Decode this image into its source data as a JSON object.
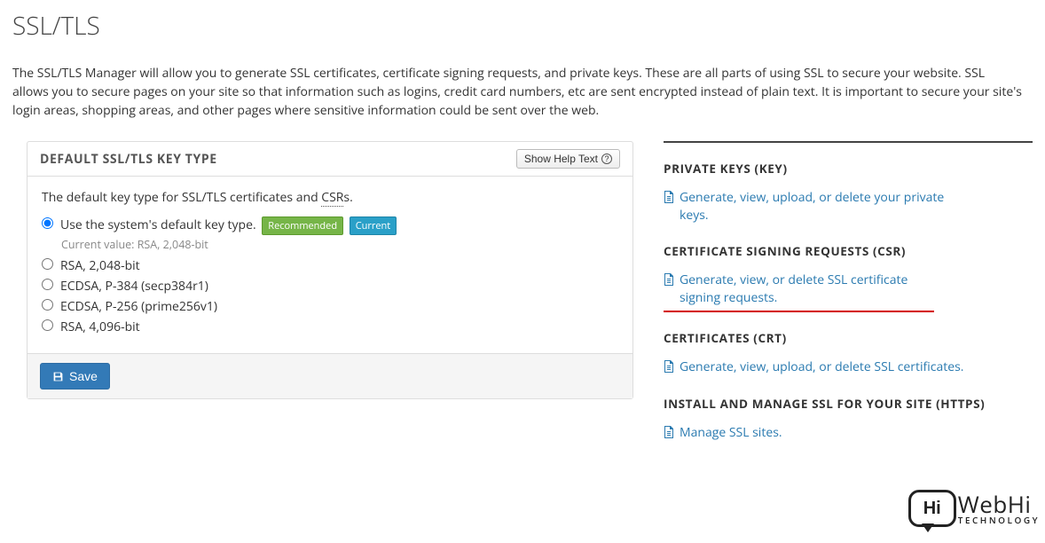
{
  "page": {
    "title": "SSL/TLS",
    "lead": "The SSL/TLS Manager will allow you to generate SSL certificates, certificate signing requests, and private keys. These are all parts of using SSL to secure your website. SSL allows you to secure pages on your site so that information such as logins, credit card numbers, etc are sent encrypted instead of plain text. It is important to secure your site's login areas, shopping areas, and other pages where sensitive information could be sent over the web."
  },
  "panel": {
    "title": "DEFAULT SSL/TLS KEY TYPE",
    "help_label": "Show Help Text",
    "intro_prefix": "The default key type for SSL/TLS certificates and ",
    "intro_abbr": "CSR",
    "intro_suffix": "s.",
    "options": {
      "0": {
        "label": "Use the system's default key type.",
        "sub": "Current value: RSA, 2,048-bit"
      },
      "1": {
        "label": "RSA, 2,048-bit"
      },
      "2": {
        "label": "ECDSA, P-384 (secp384r1)"
      },
      "3": {
        "label": "ECDSA, P-256 (prime256v1)"
      },
      "4": {
        "label": "RSA, 4,096-bit"
      }
    },
    "badge_recommended": "Recommended",
    "badge_current": "Current",
    "save_label": "Save"
  },
  "right": {
    "sections": {
      "0": {
        "title": "PRIVATE KEYS (KEY)",
        "link": "Generate, view, upload, or delete your private keys."
      },
      "1": {
        "title": "CERTIFICATE SIGNING REQUESTS (CSR)",
        "link": "Generate, view, or delete SSL certificate signing requests."
      },
      "2": {
        "title": "CERTIFICATES (CRT)",
        "link": "Generate, view, upload, or delete SSL certificates."
      },
      "3": {
        "title": "INSTALL AND MANAGE SSL FOR YOUR SITE (HTTPS)",
        "link": "Manage SSL sites."
      }
    }
  },
  "logo": {
    "bubble": "Hi",
    "big": "WebHi",
    "small": "TECHNOLOGY"
  }
}
